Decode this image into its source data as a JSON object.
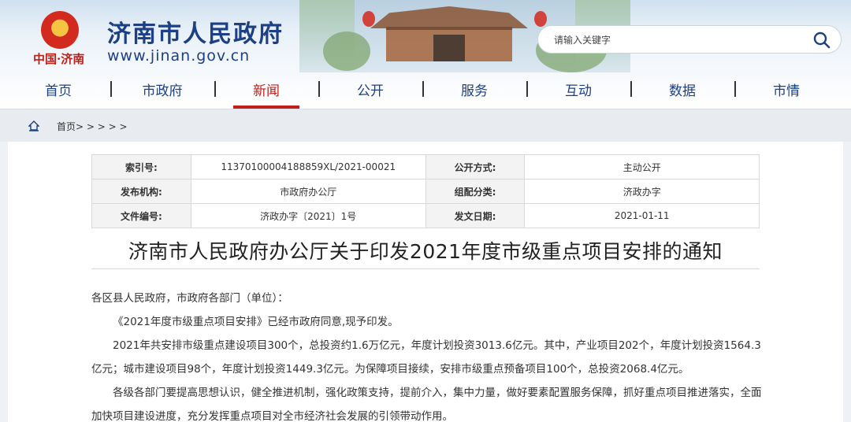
{
  "header": {
    "site_title": "济南市人民政府",
    "site_url": "www.jinan.gov.cn",
    "logo_sub": "中国·济南",
    "search_placeholder": "请输入关键字"
  },
  "nav": {
    "items": [
      "首页",
      "市政府",
      "新闻",
      "公开",
      "服务",
      "互动",
      "数据",
      "市情"
    ],
    "active": "新闻"
  },
  "breadcrumb": {
    "text": "首页> > > > >"
  },
  "meta": {
    "index_label": "索引号:",
    "index_value": "11370100004188859XL/2021-00021",
    "open_mode_label": "公开方式:",
    "open_mode_value": "主动公开",
    "publisher_label": "发布机构:",
    "publisher_value": "市政府办公厅",
    "category_label": "组配分类:",
    "category_value": "济政办字",
    "doc_no_label": "文件编号:",
    "doc_no_value": "济政办字〔2021〕1号",
    "date_label": "发文日期:",
    "date_value": "2021-01-11"
  },
  "document": {
    "title": "济南市人民政府办公厅关于印发2021年度市级重点项目安排的通知",
    "salutation": "各区县人民政府，市政府各部门（单位）：",
    "para1": "《2021年度市级重点项目安排》已经市政府同意,现予印发。",
    "para2": "2021年共安排市级重点建设项目300个，总投资约1.6万亿元，年度计划投资3013.6亿元。其中，产业项目202个，年度计划投资1564.3亿元；城市建设项目98个，年度计划投资1449.3亿元。为保障项目接续，安排市级重点预备项目100个，总投资2068.4亿元。",
    "para3": "各级各部门要提高思想认识，健全推进机制，强化政策支持，提前介入，集中力量，做好要素配置服务保障，抓好重点项目推进落实，全面加快项目建设进度，充分发挥重点项目对全市经济社会发展的引领带动作用。"
  },
  "colors": {
    "brand_blue": "#1c3f86",
    "accent_red": "#c0201a"
  }
}
